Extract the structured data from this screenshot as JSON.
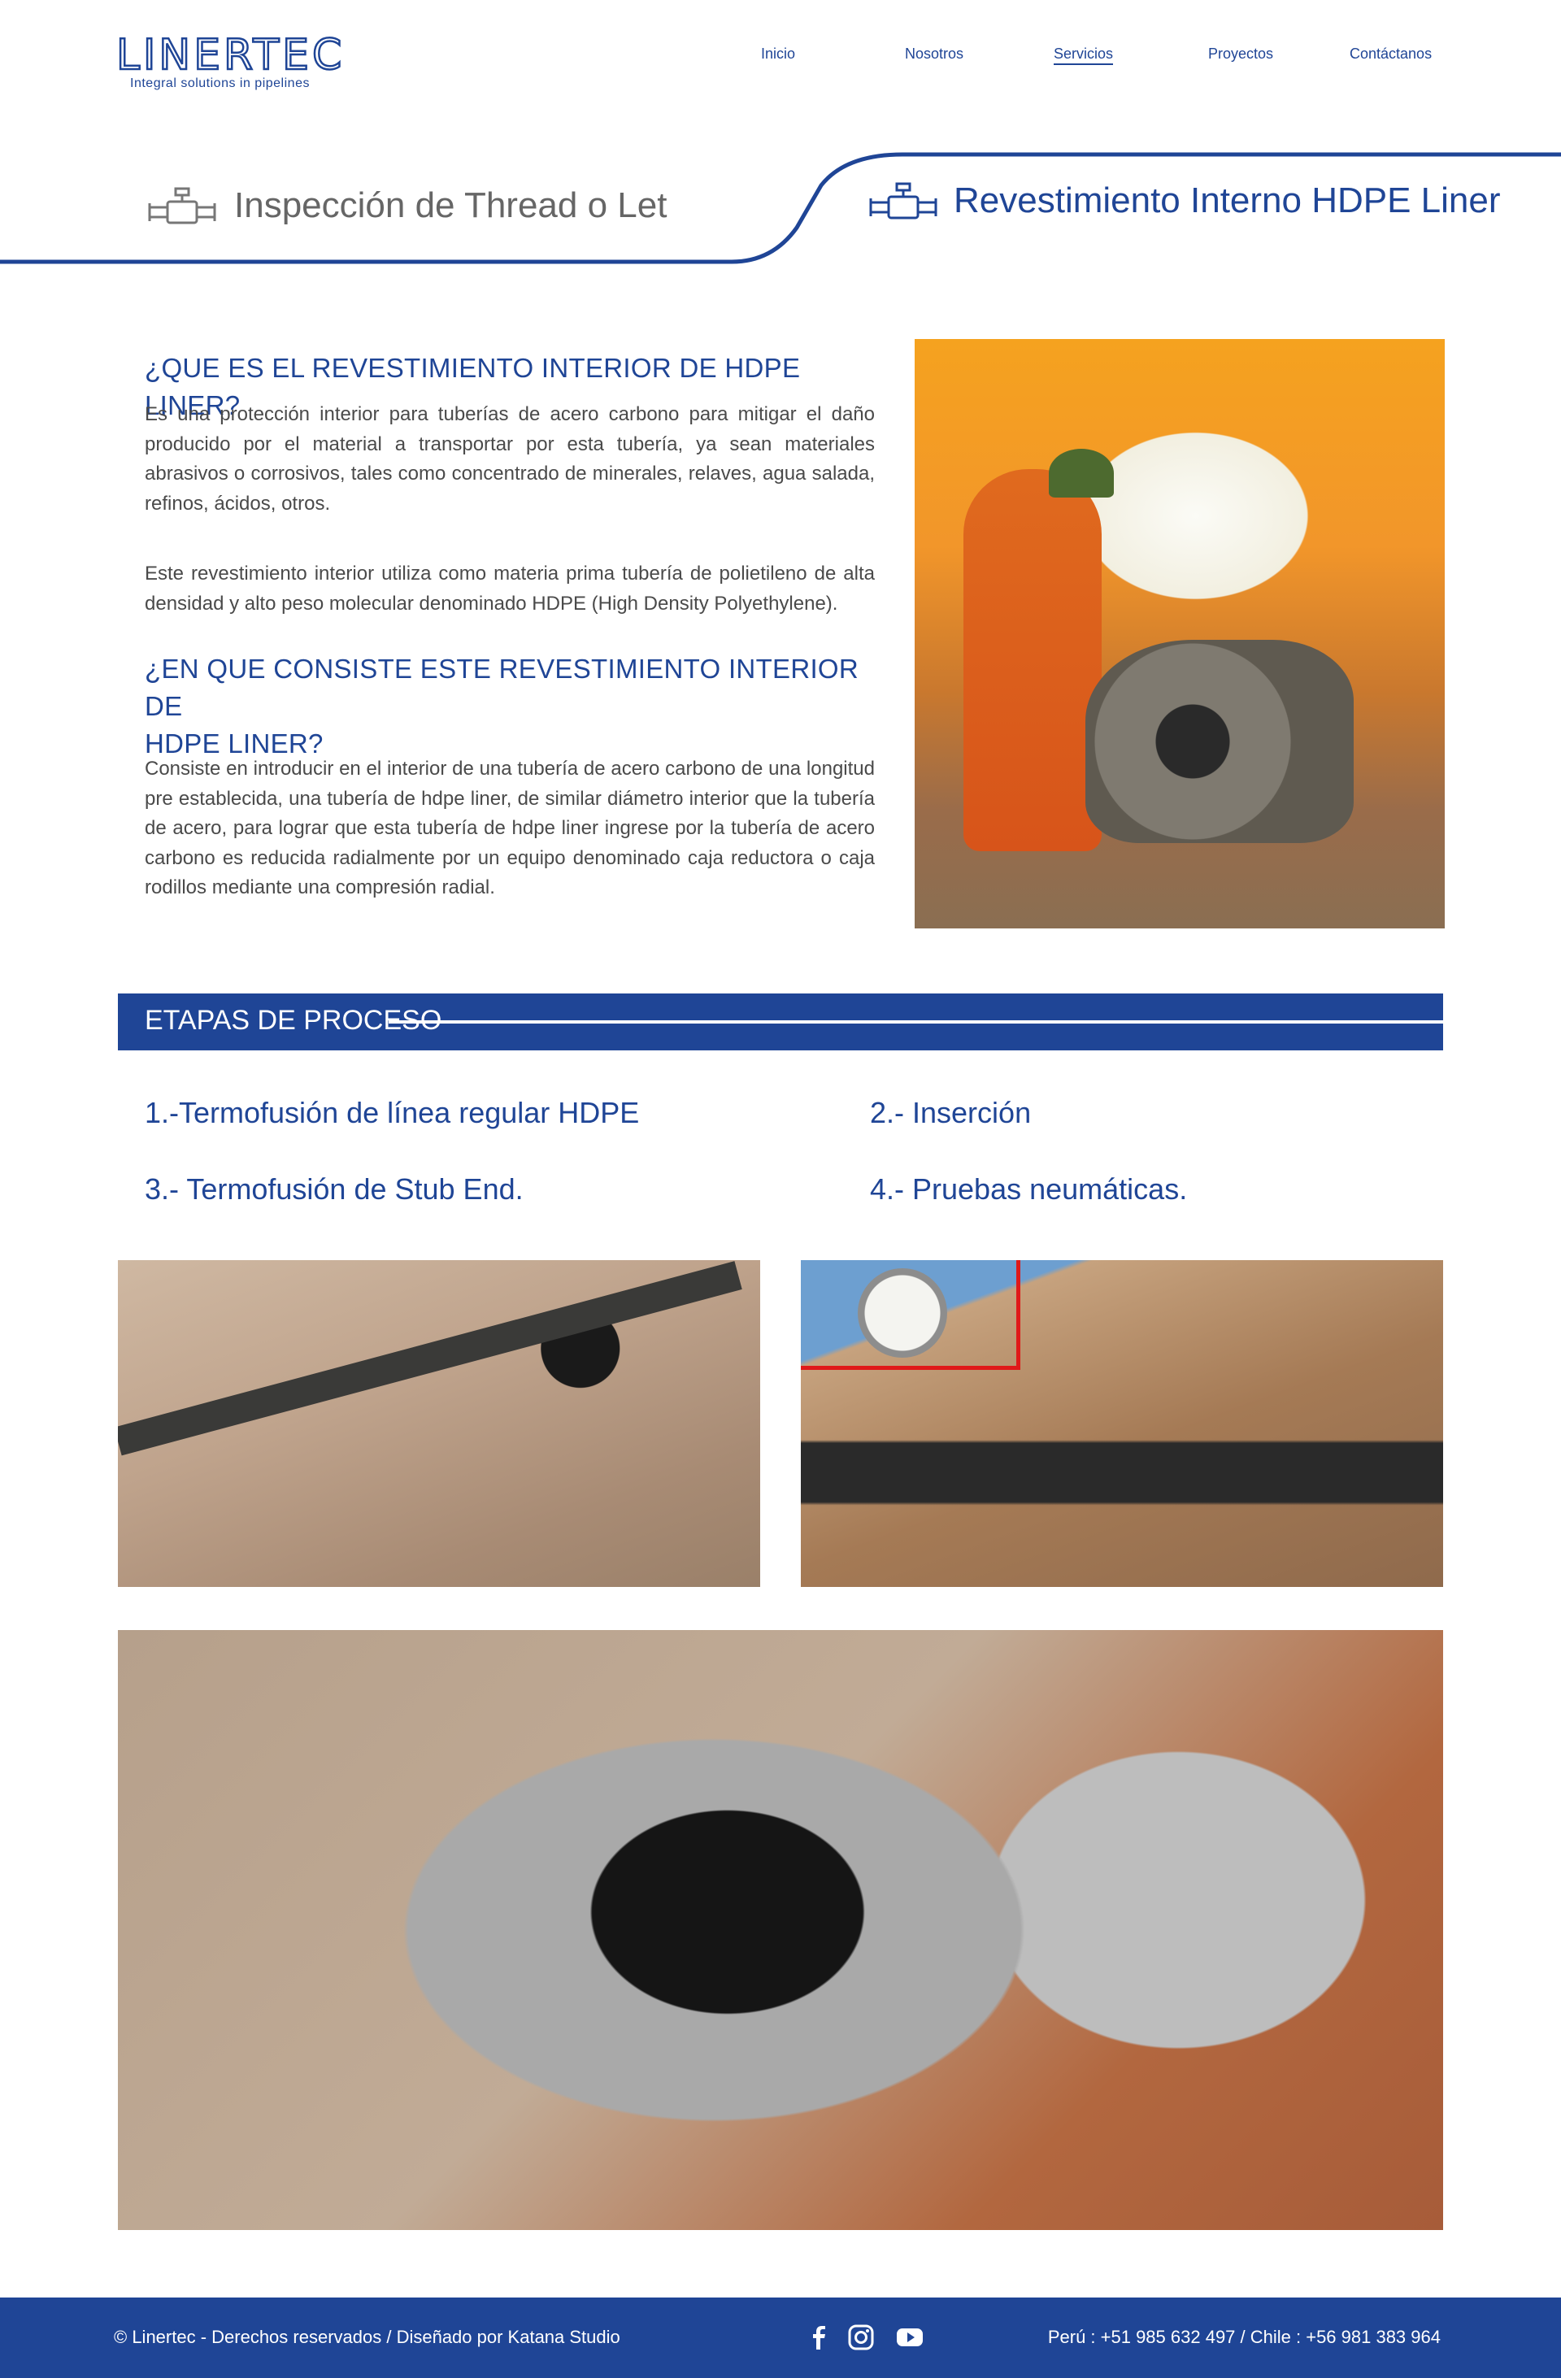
{
  "header": {
    "logo_text": "LINERTEC",
    "logo_tagline": "Integral solutions in pipelines",
    "nav": [
      {
        "label": "Inicio"
      },
      {
        "label": "Nosotros"
      },
      {
        "label": "Servicios"
      },
      {
        "label": "Proyectos"
      },
      {
        "label": "Contáctanos"
      }
    ]
  },
  "tabs": {
    "inactive_label": "Inspección de Thread o Let",
    "active_label": "Revestimiento Interno HDPE Liner"
  },
  "intro": {
    "heading1": "¿QUE ES EL REVESTIMIENTO INTERIOR DE HDPE LINER?",
    "para1": "Es una protección interior para tuberías de acero carbono para mitigar el daño producido por el material a transportar por esta tubería, ya sean materiales abrasivos o corrosivos, tales como concentrado de minerales, relaves, agua salada, refinos, ácidos, otros.",
    "para2": "Este revestimiento interior utiliza como materia prima tubería de polietileno de alta densidad y alto peso molecular denominado HDPE  (High Density Polyethylene).",
    "heading2_line1": "¿EN QUE CONSISTE ESTE REVESTIMIENTO INTERIOR DE",
    "heading2_line2": "HDPE LINER?",
    "para3": "Consiste en introducir en el interior de una tubería de acero carbono de una longitud pre establecida, una tubería de hdpe liner, de similar diámetro interior que la tubería de acero, para lograr que esta tubería de hdpe liner ingrese por la tubería de acero carbono es reducida radialmente por un equipo denominado caja reductora o caja rodillos mediante una compresión radial."
  },
  "process": {
    "title": "ETAPAS DE PROCESO",
    "steps": [
      {
        "label": "1.-Termofusión de línea regular HDPE"
      },
      {
        "label": "2.- Inserción"
      },
      {
        "label": "3.- Termofusión de Stub End."
      },
      {
        "label": "4.- Pruebas neumáticas."
      }
    ]
  },
  "footer": {
    "copyright": "© Linertec - Derechos reservados / Diseñado por Katana Studio",
    "contact": "Perú : +51 985 632 497  / Chile : +56 981 383 964",
    "social_icons": [
      "facebook-icon",
      "instagram-icon",
      "youtube-icon"
    ]
  },
  "colors": {
    "brand_blue": "#1f4596",
    "text_gray": "#4a4a4a"
  }
}
